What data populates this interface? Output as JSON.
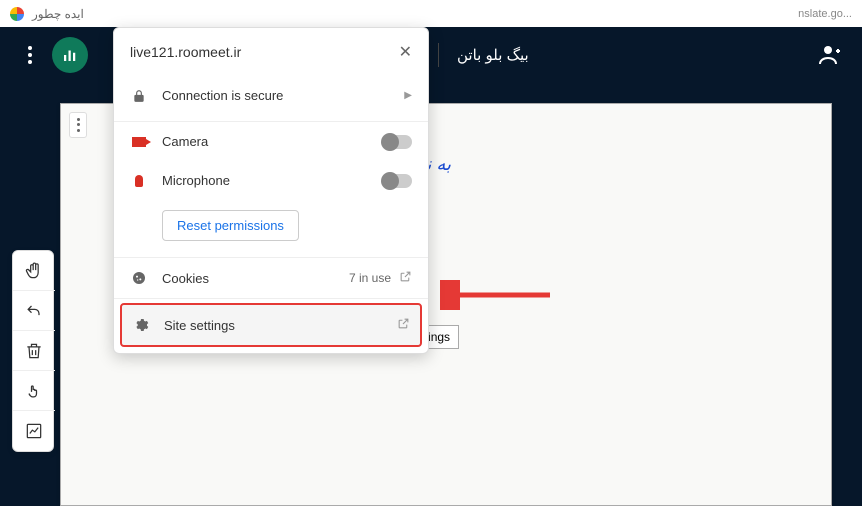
{
  "browser": {
    "tab_text": "ایده چطور",
    "url_fragment": "nslate.go..."
  },
  "header": {
    "title": "بیگ بلو باتن"
  },
  "whiteboard": {
    "text": "به نام"
  },
  "popup": {
    "domain": "live121.roomeet.ir",
    "connection": "Connection is secure",
    "camera": "Camera",
    "microphone": "Microphone",
    "reset": "Reset permissions",
    "cookies": "Cookies",
    "cookies_count": "7 in use",
    "site_settings": "Site settings",
    "tooltip": "Go to site settings"
  }
}
